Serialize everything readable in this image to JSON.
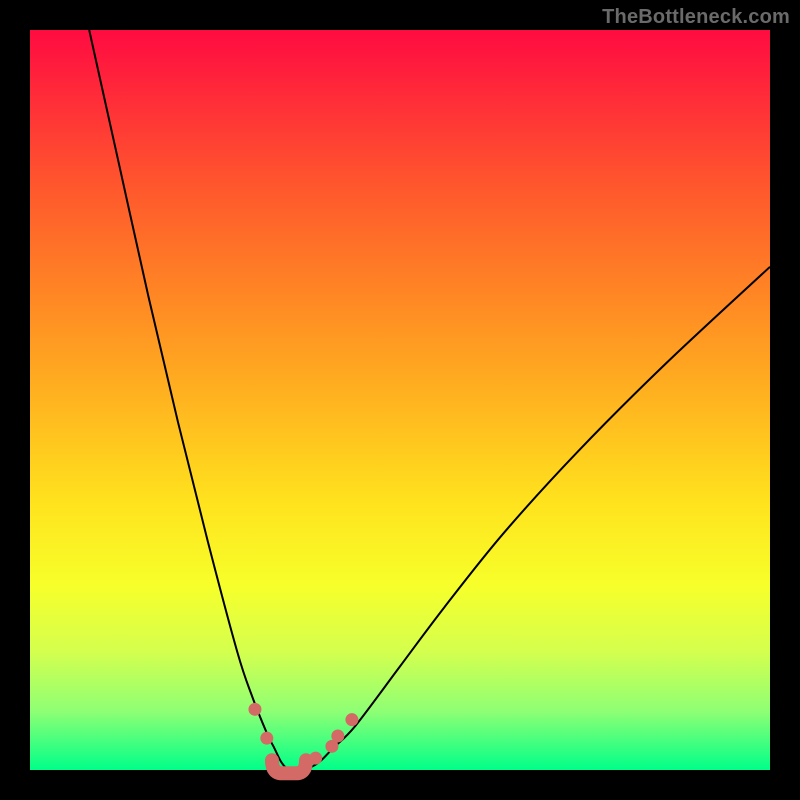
{
  "watermark": "TheBottleneck.com",
  "chart_data": {
    "type": "line",
    "title": "",
    "xlabel": "",
    "ylabel": "",
    "xlim": [
      0,
      100
    ],
    "ylim": [
      0,
      100
    ],
    "grid": false,
    "series": [
      {
        "name": "bottleneck-curve",
        "x": [
          8,
          12,
          16,
          20,
          24,
          28,
          30,
          32,
          33,
          34,
          35,
          36,
          37,
          39,
          41,
          44,
          50,
          56,
          64,
          74,
          86,
          100
        ],
        "y": [
          100,
          82,
          64,
          47,
          31,
          16,
          10,
          5,
          3,
          1,
          0,
          0,
          0,
          1,
          3,
          6,
          14,
          22,
          32,
          43,
          55,
          68
        ]
      }
    ],
    "markers": {
      "name": "highlight-dots",
      "color": "#d46a66",
      "points": [
        {
          "x": 30.4,
          "y": 8.2
        },
        {
          "x": 32.0,
          "y": 4.3
        },
        {
          "x": 38.6,
          "y": 1.6
        },
        {
          "x": 40.8,
          "y": 3.2
        },
        {
          "x": 41.6,
          "y": 4.6
        },
        {
          "x": 43.5,
          "y": 6.8
        }
      ]
    },
    "min_region": {
      "x_start": 32.7,
      "x_end": 37.3,
      "y": 0.5,
      "color": "#d46a66"
    }
  },
  "colors": {
    "curve": "#000000",
    "dot": "#d46a66",
    "frame": "#000000"
  }
}
